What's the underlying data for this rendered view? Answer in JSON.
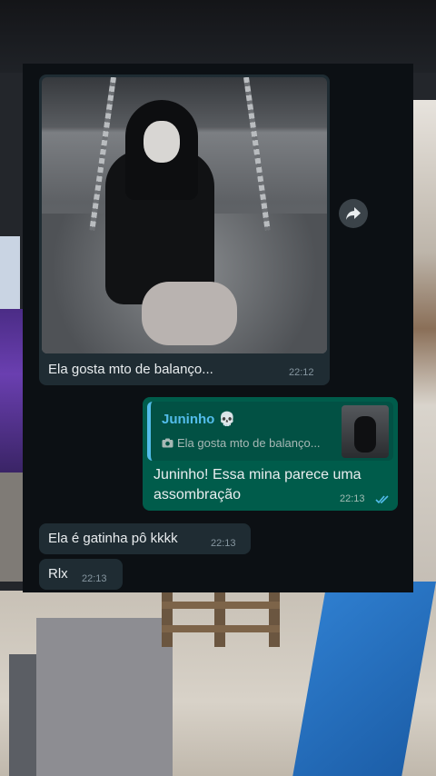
{
  "colors": {
    "chat_bg": "#0c1014",
    "incoming_bubble": "#1f2c33",
    "outgoing_bubble": "#005c4b",
    "reply_accent": "#53bdeb",
    "read_ticks": "#53bdeb"
  },
  "messages": {
    "image_message": {
      "caption": "Ela gosta mto de balanço...",
      "time": "22:12"
    },
    "outgoing": {
      "reply_name": "Juninho 💀",
      "reply_icon": "camera-icon",
      "reply_text": "Ela gosta mto de balanço...",
      "text": "Juninho! Essa mina parece uma assombração",
      "time": "22:13",
      "status_icon": "double-check-icon"
    },
    "incoming_1": {
      "text": "Ela é gatinha pô kkkk",
      "time": "22:13"
    },
    "incoming_2": {
      "text": "Rlx",
      "time": "22:13"
    }
  },
  "forward_button_icon": "forward-arrow-icon"
}
